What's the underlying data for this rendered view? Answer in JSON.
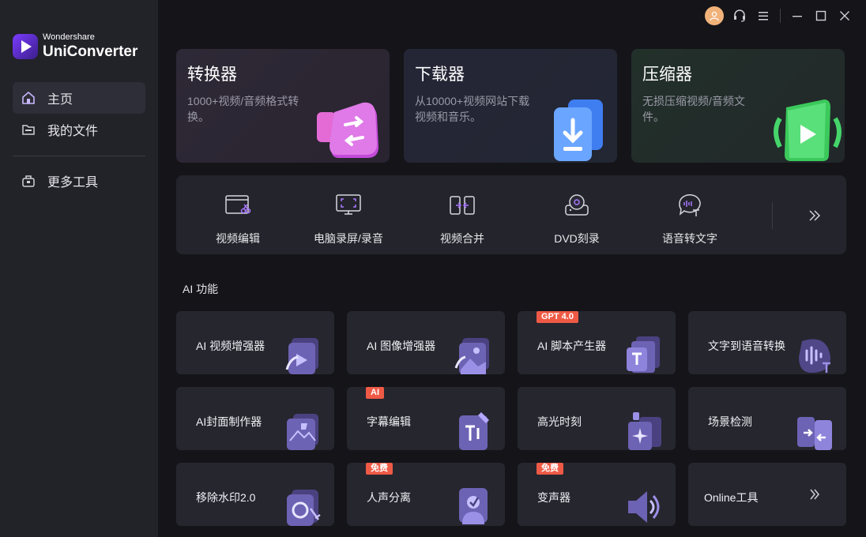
{
  "app": {
    "brand_sub": "Wondershare",
    "brand_main": "UniConverter"
  },
  "sidebar": {
    "items": [
      {
        "label": "主页",
        "icon": "home-icon",
        "active": true
      },
      {
        "label": "我的文件",
        "icon": "folder-icon",
        "active": false
      },
      {
        "label": "更多工具",
        "icon": "toolbox-icon",
        "active": false
      }
    ]
  },
  "topbar": {
    "icons": [
      "avatar-icon",
      "headset-icon",
      "menu-icon",
      "minimize-icon",
      "maximize-icon",
      "close-icon"
    ]
  },
  "feature_cards": [
    {
      "title": "转换器",
      "desc": "1000+视频/音频格式转换。",
      "icon": "converter-icon"
    },
    {
      "title": "下载器",
      "desc": "从10000+视频网站下载视频和音乐。",
      "icon": "downloader-icon"
    },
    {
      "title": "压缩器",
      "desc": "无损压缩视频/音频文件。",
      "icon": "compressor-icon"
    }
  ],
  "tools": [
    {
      "label": "视频编辑",
      "icon": "video-edit-icon"
    },
    {
      "label": "电脑录屏/录音",
      "icon": "screen-record-icon"
    },
    {
      "label": "视频合并",
      "icon": "video-merge-icon"
    },
    {
      "label": "DVD刻录",
      "icon": "dvd-burn-icon"
    },
    {
      "label": "语音转文字",
      "icon": "speech-to-text-icon"
    }
  ],
  "ai_section": {
    "title": "AI 功能",
    "cards": [
      {
        "label": "AI 视频增强器",
        "badge": ""
      },
      {
        "label": "AI 图像增强器",
        "badge": ""
      },
      {
        "label": "AI 脚本产生器",
        "badge": "GPT 4.0"
      },
      {
        "label": "文字到语音转换",
        "badge": ""
      },
      {
        "label": "AI封面制作器",
        "badge": ""
      },
      {
        "label": "字幕编辑",
        "badge": "AI"
      },
      {
        "label": "高光时刻",
        "badge": ""
      },
      {
        "label": "场景检测",
        "badge": ""
      },
      {
        "label": "移除水印2.0",
        "badge": ""
      },
      {
        "label": "人声分离",
        "badge": "免费"
      },
      {
        "label": "变声器",
        "badge": "免费"
      },
      {
        "label": "Online工具",
        "badge": ""
      }
    ]
  },
  "colors": {
    "accent": "#7b3cff",
    "badge": "#ee5a45",
    "bg": "#141419",
    "sidebar": "#222229",
    "card": "#26262f"
  }
}
